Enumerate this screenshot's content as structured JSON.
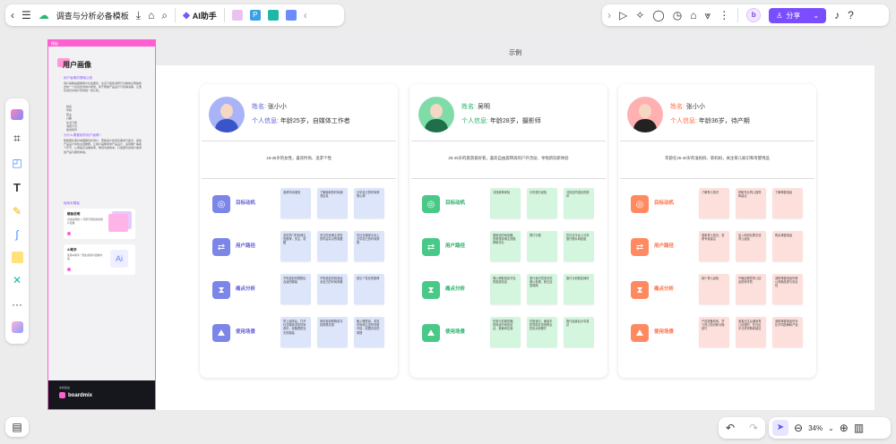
{
  "toolbar": {
    "doc_title": "调查与分析必备模板",
    "ai_label": "AI助手",
    "share_label": "分享"
  },
  "zoom": {
    "value": "34%"
  },
  "frame": {
    "title": "示例"
  },
  "left_panel": {
    "tag": "模板",
    "title": "用户画像",
    "section1": "用户画像的基础认知",
    "para1": "用户画像是根据用户社会属性、生活习惯和消费行为等信息而抽象出的一个标签化的用户模型，用于帮助产品设计与营销决策，让团队成员对用户形成统一的认知。",
    "bullets": [
      "姓名",
      "年龄",
      "职业",
      "兴趣",
      "生活习惯",
      "消费行为",
      "使用场景"
    ],
    "section2": "为什么需要制作用户画像?",
    "para2": "帮助团队更好地理解目标用户，聚焦用户的真实需求与痛点，避免产品设计中的主观臆断。让用户画像贯穿产品设计、运营推广等各个环节，从而提高决策效率，降低沟通成本，打造更符合用户需求的产品与服务体验。",
    "section3": "使用本模板",
    "card1_title": "模板说明",
    "card1_desc": "点击右侧的“+”号即可添加新的用户画像",
    "card2_title": "AI助手",
    "card2_desc": "使用AI助手一键生成用户画像内容",
    "brand_top": "本模板由",
    "brand": "boardmix"
  },
  "personas": [
    {
      "name_label": "姓名:",
      "name": "张小小",
      "info_label": "个人信息:",
      "info": "年龄25岁，自媒体工作者",
      "summary": "18-35岁的女性，喜欢时尚、追求个性",
      "theme": "blue",
      "rows": [
        {
          "label": "目标动机",
          "icon": "target-icon",
          "notes": [
            "追求时尚潮流",
            "了解最新的时尚潮流信息",
            "分享自己的时尚穿搭心得"
          ]
        },
        {
          "label": "用户路径",
          "icon": "path-icon",
          "notes": [
            "浏览热门时尚博主的推荐，关注，收藏",
            "关注时尚博主发布的内容并点赞收藏",
            "在社交媒体平台上分享自己的时尚穿搭"
          ]
        },
        {
          "label": "痛点分析",
          "icon": "pain-icon",
          "notes": [
            "不知道如何搭配出合适的服装",
            "不知道如何找到适合自己的时尚风格",
            "缺乏个性化的推荐"
          ]
        },
        {
          "label": "使用场景",
          "icon": "scene-icon",
          "notes": [
            "早上起床后，打开社交媒体浏览时尚资讯，准备搭配当天的服装",
            "周末逛街购物前寻找穿搭灵感",
            "晚上睡觉前，浏览时尚博主发布的新内容，收藏喜欢的穿搭"
          ]
        }
      ]
    },
    {
      "name_label": "姓名:",
      "name": "吴明",
      "info_label": "个人信息:",
      "info": "年龄28岁，摄影师",
      "summary": "25-45岁的旅游爱好者，喜欢自由旋转高的户外活动、寻找新玩新体验",
      "theme": "green",
      "rows": [
        {
          "label": "目标动机",
          "icon": "target-icon",
          "notes": [
            "寻找新奇体验",
            "分享旅行经验",
            "寻找志同道合的旅伴"
          ]
        },
        {
          "label": "用户路径",
          "icon": "path-icon",
          "notes": [
            "搜索目的地攻略，查看旅游博主的推荐和评价",
            "预订行程",
            "在社交平台上分享旅行照片和经验"
          ]
        },
        {
          "label": "痛点分析",
          "icon": "pain-icon",
          "notes": [
            "难以获取真实可靠的旅游信息",
            "旅行途中突发状况难以处理，缺乏应急指南",
            "旅行计划制定耗时"
          ]
        },
        {
          "label": "使用场景",
          "icon": "scene-icon",
          "notes": [
            "在旅行前做攻略，查询目的地的景点、美食和住宿",
            "在旅途中，使用手机导航并查找附近的景点和餐厅",
            "旅行结束后分享游记"
          ]
        }
      ]
    },
    {
      "name_label": "姓名:",
      "name": "张小小",
      "info_label": "个人信息:",
      "info": "年龄36岁，待产期",
      "summary": "年龄在25-40岁的准妈妈、新妈妈，关注育儿知识和母婴用品",
      "theme": "red",
      "rows": [
        {
          "label": "目标动机",
          "icon": "target-icon",
          "notes": [
            "了解育儿知识",
            "获取专业育儿指导和建议",
            "了解母婴用品"
          ]
        },
        {
          "label": "用户路径",
          "icon": "path-icon",
          "notes": [
            "搜索育儿知识，查看专家建议",
            "加入妈妈社群交流育儿经验",
            "购买母婴用品"
          ]
        },
        {
          "label": "痛点分析",
          "icon": "pain-icon",
          "notes": [
            "缺少育儿经验",
            "不确定哪些育儿信息是科学的",
            "选购母婴用品时难以判断品质与安全性"
          ]
        },
        {
          "label": "使用场景",
          "icon": "scene-icon",
          "notes": [
            "产前准备阶段，学习育儿知识和分娩技巧",
            "宝宝出生后遇到育儿问题时，在社区中寻求帮助和建议",
            "选购母婴用品时对比不同品牌和产品"
          ]
        }
      ]
    }
  ]
}
